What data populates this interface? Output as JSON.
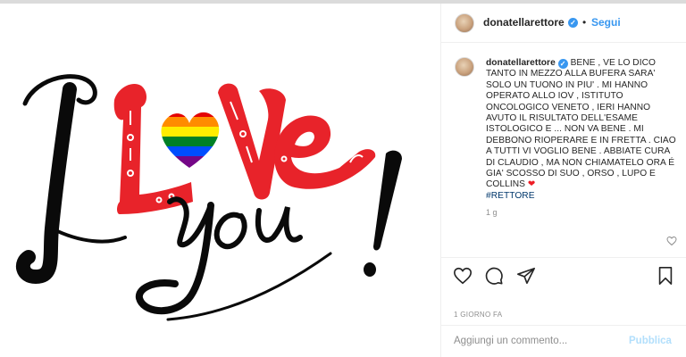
{
  "post": {
    "image_alt_text": [
      "I",
      "L",
      "ve",
      "you",
      "!"
    ],
    "colors": {
      "ink": "#0a0a0a",
      "red": "#e8232a",
      "rainbow": [
        "#e40303",
        "#ff8c00",
        "#ffed00",
        "#008026",
        "#004dff",
        "#750787"
      ]
    }
  },
  "header": {
    "username": "donatellarettore",
    "verified_icon": "verified-badge-icon",
    "separator": "•",
    "follow_label": "Segui"
  },
  "caption": {
    "username": "donatellarettore",
    "text": "BENE , VE LO DICO TANTO IN MEZZO ALLA BUFERA SARA' SOLO UN TUONO IN PIU' . MI HANNO OPERATO ALLO IOV , ISTITUTO ONCOLOGICO VENETO , IERI HANNO AVUTO IL RISULTATO DELL'ESAME ISTOLOGICO E ... NON VA BENE . MI DEBBONO RIOPERARE E IN FRETTA . CIAO A TUTTI VI VOGLIO BENE . ABBIATE CURA DI CLAUDIO , MA NON CHIAMATELO ORA É GIA' SCOSSO DI SUO , ORSO , LUPO E COLLINS",
    "emoji": "❤",
    "hashtag": "#RETTORE",
    "time": "1 g"
  },
  "actions": {
    "icons": [
      "heart-icon",
      "comment-icon",
      "share-icon",
      "bookmark-icon"
    ]
  },
  "meta": {
    "date": "1 GIORNO FA"
  },
  "comment_box": {
    "placeholder": "Aggiungi un commento...",
    "publish_label": "Pubblica"
  }
}
